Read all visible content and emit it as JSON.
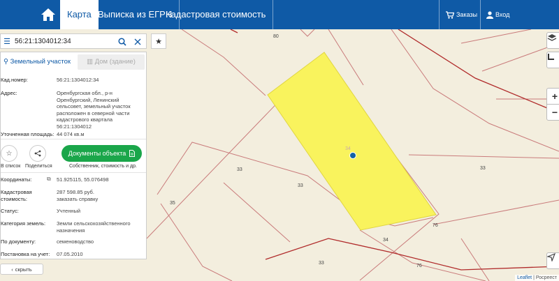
{
  "header": {
    "tabs": [
      {
        "label": "Карта",
        "active": true
      },
      {
        "label": "Выписка из ЕГРН",
        "active": false
      },
      {
        "label": "Кадастровая стоимость",
        "active": false
      }
    ],
    "orders_label": "Заказы",
    "login_label": "Вход",
    "bg_color": "#0f5aa6"
  },
  "search": {
    "value": "56:21:1304012:34",
    "icons": [
      "menu-icon",
      "search-icon",
      "close-icon"
    ]
  },
  "panel": {
    "tabs": [
      {
        "label": "Земельный участок",
        "icon": "map-pin-icon",
        "active": true
      },
      {
        "label": "Дом (здание)",
        "icon": "building-icon",
        "active": false
      }
    ],
    "fields": {
      "cad_number": {
        "label": "Кад.номер:",
        "value": "56:21:1304012:34"
      },
      "address": {
        "label": "Адрес:",
        "value": "Оренбургская обл., р-н Оренбургский, Ленинский сельсовет, земельный участок расположен в северной части кадастрового квартала 56:21:1304012"
      },
      "area": {
        "label": "Уточненная площадь:",
        "value": "44 074 кв.м"
      },
      "coords": {
        "label": "Координаты:",
        "value": "51.925115, 55.076498"
      },
      "cad_cost": {
        "label": "Кадастровая стоимость:",
        "value": "287 598.85 руб.",
        "link": "заказать справку"
      },
      "status": {
        "label": "Статус:",
        "value": "Учтенный"
      },
      "category": {
        "label": "Категория земель:",
        "value": "Земли сельскохозяйственного назначения"
      },
      "by_doc": {
        "label": "По документу:",
        "value": "семеноводство"
      },
      "registered": {
        "label": "Постановка на учет:",
        "value": "07.05.2010"
      }
    },
    "actions": {
      "add_to_list": "В список",
      "share": "Поделиться",
      "documents_button": "Документы объекта",
      "documents_caption": "Собственник, стоимость и др."
    },
    "collapse_label": "скрыть"
  },
  "map": {
    "highlight_color": "#f9f35d",
    "parcel_labels": [
      "80",
      "34",
      "33",
      "33",
      "33",
      "35",
      "34",
      "76",
      "33",
      "76"
    ],
    "attribution": "Leaflet",
    "attribution_rest": " | Росреест"
  }
}
